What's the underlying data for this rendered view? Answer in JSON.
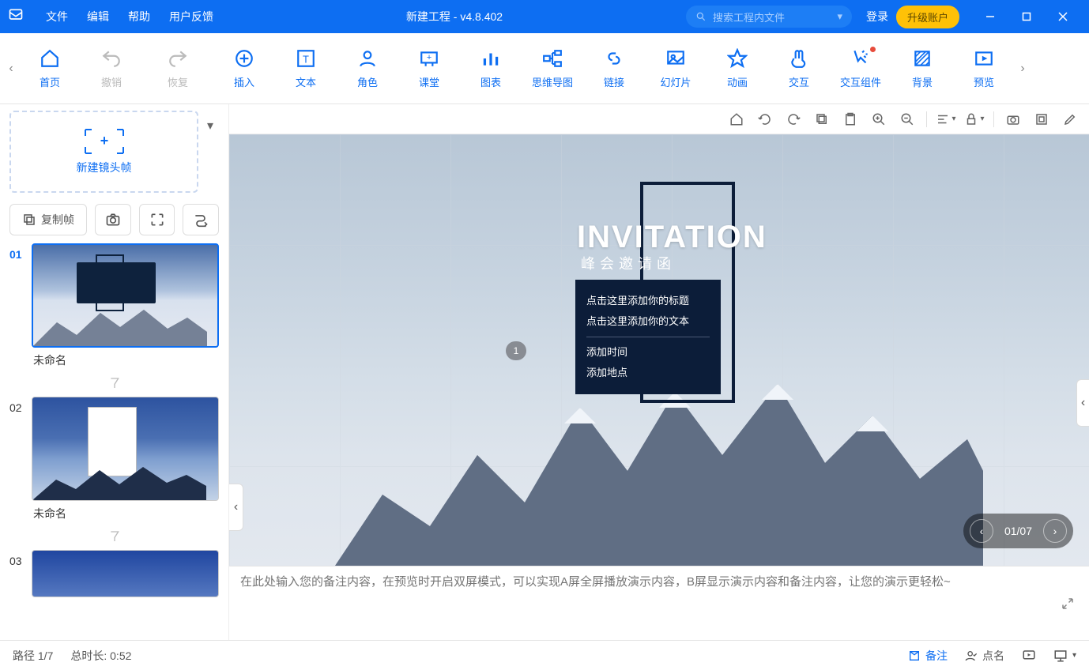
{
  "titlebar": {
    "menus": {
      "file": "文件",
      "edit": "编辑",
      "help": "帮助",
      "feedback": "用户反馈"
    },
    "title": "新建工程 - v4.8.402",
    "search_placeholder": "搜索工程内文件",
    "login": "登录",
    "upgrade": "升级账户"
  },
  "ribbon": {
    "home": "首页",
    "undo": "撤销",
    "redo": "恢复",
    "insert": "插入",
    "text": "文本",
    "role": "角色",
    "class": "课堂",
    "chart": "图表",
    "mindmap": "思维导图",
    "link": "链接",
    "slideshow": "幻灯片",
    "animation": "动画",
    "interact": "交互",
    "interact_widget": "交互组件",
    "background": "背景",
    "preview": "预览"
  },
  "left": {
    "new_lens": "新建镜头帧",
    "copy_frame": "复制帧",
    "slides": [
      {
        "num": "01",
        "name": "未命名"
      },
      {
        "num": "02",
        "name": "未命名"
      },
      {
        "num": "03",
        "name": ""
      }
    ]
  },
  "canvas": {
    "inv_title": "INVITATION",
    "inv_sub": "峰会邀请函",
    "line1": "点击这里添加你的标题",
    "line2": "点击这里添加你的文本",
    "line3": "添加时间",
    "line4": "添加地点",
    "step": "1",
    "pager": "01/07"
  },
  "notes": {
    "placeholder": "在此处输入您的备注内容，在预览时开启双屏模式，可以实现A屏全屏播放演示内容，B屏显示演示内容和备注内容，让您的演示更轻松~"
  },
  "statusbar": {
    "path": "路径 1/7",
    "duration": "总时长: 0:52",
    "notes_btn": "备注",
    "roll_btn": "点名"
  }
}
